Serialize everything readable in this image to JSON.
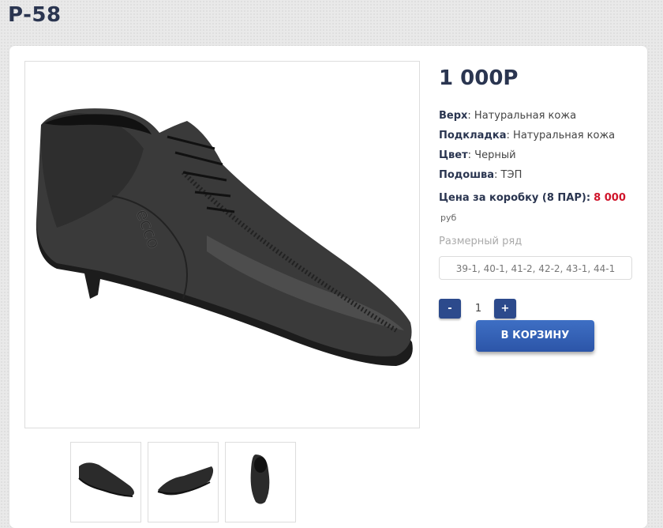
{
  "product": {
    "title": "P-58",
    "price": "1 000Р",
    "specs": [
      {
        "label": "Верх",
        "value": ": Натуральная кожа"
      },
      {
        "label": "Подкладка",
        "value": ": Натуральная кожа"
      },
      {
        "label": "Цвет",
        "value": ": Черный"
      },
      {
        "label": "Подошва",
        "value": ": ТЭП"
      }
    ],
    "box_price_label": "Цена за коробку (8 ПАР):",
    "box_price_value": "8 000",
    "box_price_currency": "руб",
    "size_label": "Размерный ряд",
    "size_value": "39-1, 40-1, 41-2, 42-2, 43-1, 44-1",
    "qty_minus": "-",
    "qty_value": "1",
    "qty_plus": "+",
    "cart_button": "В КОРЗИНУ",
    "main_image_logo": "ecco"
  },
  "colors": {
    "accent": "#2c4a8c",
    "price_red": "#d0152b",
    "title": "#2a3550"
  }
}
